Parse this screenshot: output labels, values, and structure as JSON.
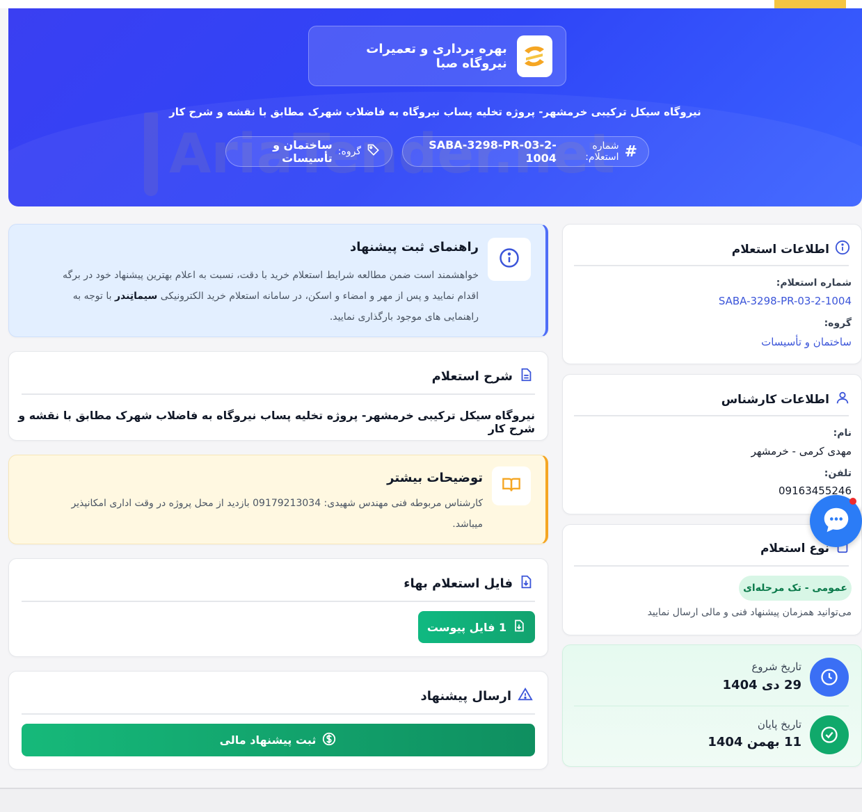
{
  "header": {
    "brand_name": "بهره برداری و تعمیرات نیروگاه صبا",
    "title": "نیروگاه سیکل ترکیبی خرمشهر- پروژه تخلیه پساب نیروگاه به فاضلاب شهرک مطابق با نقشه و شرح کار",
    "number_label": "شماره استعلام:",
    "number_value": "SABA-3298-PR-03-2-1004",
    "group_label": "گروه:",
    "group_value": "ساختمان و تأسیسات",
    "watermark": "AriaTender.net"
  },
  "inquiry_info": {
    "title": "اطلاعات استعلام",
    "number_label": "شماره استعلام:",
    "number_value": "SABA-3298-PR-03-2-1004",
    "group_label": "گروه:",
    "group_value": "ساختمان و تأسیسات"
  },
  "expert_info": {
    "title": "اطلاعات کارشناس",
    "name_label": "نام:",
    "name_value": "مهدی کرمی - خرمشهر",
    "phone_label": "تلفن:",
    "phone_value": "09163455246"
  },
  "inquiry_type": {
    "title": "نوع استعلام",
    "badge": "عمومی - تک مرحله‌ای",
    "note": "می‌توانید همزمان پیشنهاد فنی و مالی ارسال نمایید"
  },
  "dates": {
    "start_label": "تاریخ شروع",
    "start_value": "29 دی 1404",
    "end_label": "تاریخ پایان",
    "end_value": "11 بهمن 1404"
  },
  "guide": {
    "title": "راهنمای ثبت پیشنهاد",
    "line1": "خواهشمند است ضمن مطالعه شرایط استعلام خرید با دقت، نسبت به اعلام بهترین پیشنهاد خود در برگه",
    "line2_a": "اقدام نمایید و پس از مهر و امضاء و اسکن، در سامانه استعلام خرید الکترونیکی ",
    "line2_brand": "سیماتِندر",
    "line2_b": " با توجه به",
    "line3": "راهنمایی های موجود بارگذاری نمایید."
  },
  "description": {
    "title": "شرح استعلام",
    "text": "نیروگاه سیکل ترکیبی خرمشهر- پروژه تخلیه پساب نیروگاه به فاضلاب شهرک مطابق با نقشه و شرح کار"
  },
  "more_info": {
    "title": "توضیحات بیشتر",
    "line1": "کارشناس مربوطه فنی مهندس شهیدی: 09179213034 بازدید از محل پروژه در وقت اداری امکانپذیر",
    "line2": "میباشد."
  },
  "file_section": {
    "title": "فایل استعلام بهاء",
    "button_label": "1 فایل پیوست"
  },
  "send_section": {
    "title": "ارسال پیشنهاد",
    "button_label": "ثبت پیشنهاد مالی"
  },
  "colors": {
    "primary": "#2f45f7",
    "accent_yellow": "#f5c542",
    "green": "#10b981",
    "link_blue": "#3b55d9"
  }
}
